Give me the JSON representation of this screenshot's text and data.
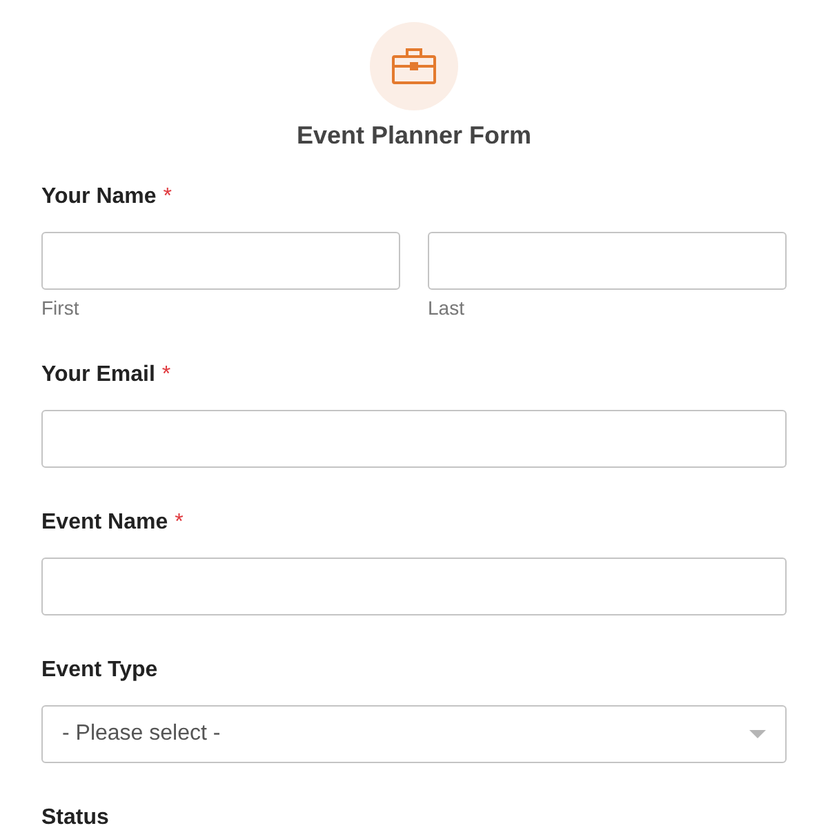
{
  "form": {
    "title": "Event Planner Form"
  },
  "fields": [
    {
      "kind": "name",
      "label": "Your Name",
      "required_mark": "*",
      "parts": [
        {
          "sublabel": "First"
        },
        {
          "sublabel": "Last"
        }
      ]
    },
    {
      "kind": "text",
      "label": "Your Email",
      "required_mark": "*"
    },
    {
      "kind": "text",
      "label": "Event Name",
      "required_mark": "*"
    },
    {
      "kind": "select",
      "label": "Event Type",
      "placeholder": "- Please select -"
    },
    {
      "kind": "label",
      "label": "Status"
    }
  ]
}
